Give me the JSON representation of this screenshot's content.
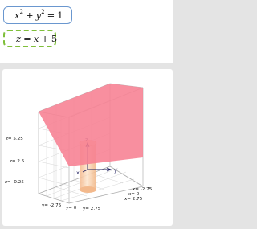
{
  "equations": [
    {
      "lhs_var1": "x",
      "sup1": "2",
      "plus": "+",
      "lhs_var2": "y",
      "sup2": "2",
      "eq": "=",
      "rhs": "1"
    },
    {
      "lhs": "z",
      "eq": "=",
      "rhs_var": "x",
      "plus": "+",
      "rhs_const": "5"
    }
  ],
  "plot": {
    "z_ticks": [
      "z= 5.25",
      "z= 2.5",
      "z= -0.25"
    ],
    "y_ticks": [
      "y= -2.75",
      "y= 0",
      "y= 2.75"
    ],
    "x_ticks": [
      "x= -2.75",
      "x= 0",
      "x= 2.75"
    ],
    "axis_labels": {
      "x": "x",
      "y": "y",
      "z": "z"
    },
    "colors": {
      "plane": "#f77f92",
      "cylinder": "#f7c9a2",
      "grid": "#c8c8c8",
      "axes": "#1a1a5a"
    }
  }
}
